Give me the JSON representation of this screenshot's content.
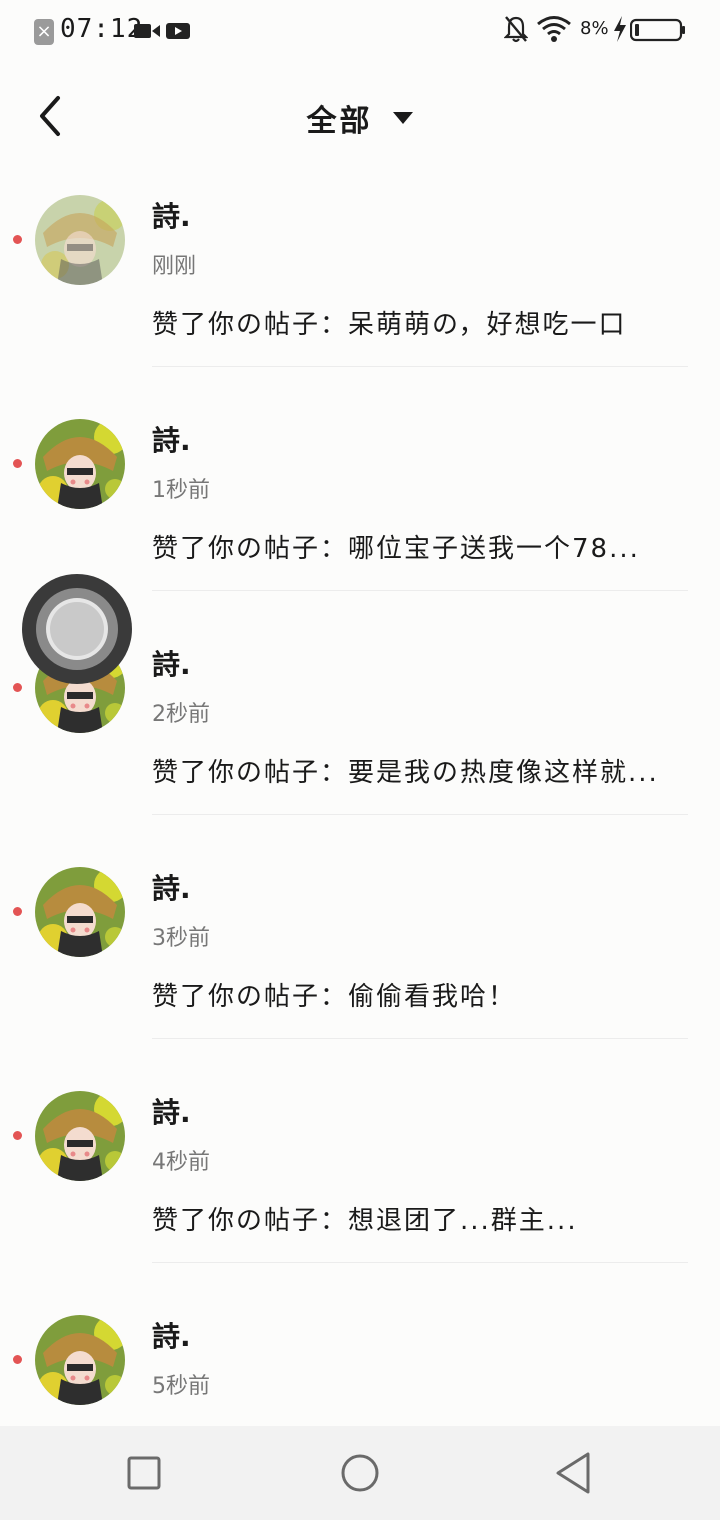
{
  "status_bar": {
    "time": "07:12",
    "battery_percent": "8%",
    "icons": [
      "notification-x-icon",
      "video-icon",
      "video-play-icon",
      "silent-bell-icon",
      "wifi-icon",
      "charging-icon",
      "battery-icon"
    ]
  },
  "header": {
    "title": "全部",
    "icons": [
      "back-arrow-icon",
      "dropdown-caret-icon"
    ]
  },
  "notifications": [
    {
      "name": "詩.",
      "time": "刚刚",
      "content": "赞了你の帖子：呆萌萌の，好想吃一口"
    },
    {
      "name": "詩.",
      "time": "1秒前",
      "content": "赞了你の帖子：哪位宝子送我一个78..."
    },
    {
      "name": "詩.",
      "time": "2秒前",
      "content": "赞了你の帖子：要是我の热度像这样就..."
    },
    {
      "name": "詩.",
      "time": "3秒前",
      "content": "赞了你の帖子：偷偷看我哈！"
    },
    {
      "name": "詩.",
      "time": "4秒前",
      "content": "赞了你の帖子：想退团了...群主..."
    },
    {
      "name": "詩.",
      "time": "5秒前",
      "content": ""
    }
  ],
  "colors": {
    "unread_dot": "#e35454",
    "background": "#fcfcfb",
    "navbar": "#f2f2f2"
  },
  "navbar": {
    "icons": [
      "recents-square-icon",
      "home-circle-icon",
      "back-triangle-icon"
    ]
  }
}
